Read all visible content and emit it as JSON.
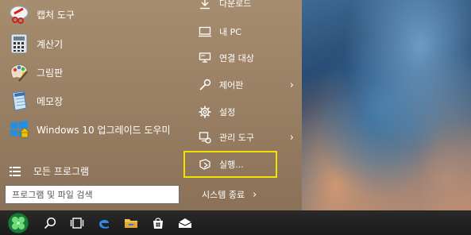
{
  "start_menu": {
    "apps": [
      {
        "label": "캡처 도구",
        "icon": "snipping-tool-icon"
      },
      {
        "label": "계산기",
        "icon": "calculator-icon"
      },
      {
        "label": "그림판",
        "icon": "paint-icon"
      },
      {
        "label": "메모장",
        "icon": "notepad-icon"
      },
      {
        "label": "Windows 10 업그레이드 도우미",
        "icon": "windows-upgrade-icon"
      }
    ],
    "all_programs_label": "모든 프로그램",
    "search_placeholder": "프로그램 및 파일 검색",
    "places": [
      {
        "label": "다운로드",
        "icon": "download-icon",
        "has_submenu": false
      },
      {
        "label": "내 PC",
        "icon": "computer-icon",
        "has_submenu": false
      },
      {
        "label": "연결 대상",
        "icon": "connect-to-icon",
        "has_submenu": false
      },
      {
        "label": "제어판",
        "icon": "control-panel-icon",
        "has_submenu": true
      },
      {
        "label": "설정",
        "icon": "gear-icon",
        "has_submenu": false
      },
      {
        "label": "관리 도구",
        "icon": "admin-tools-icon",
        "has_submenu": true
      },
      {
        "label": "실행...",
        "icon": "run-icon",
        "has_submenu": false
      }
    ],
    "shutdown_label": "시스템 종료",
    "chevron": "›"
  },
  "highlight": {
    "target": "실행...",
    "color": "#f2e200"
  },
  "taskbar": {
    "items": [
      "start-orb-icon",
      "search-icon",
      "task-view-icon",
      "edge-icon",
      "file-explorer-icon",
      "store-icon",
      "mail-icon"
    ]
  },
  "colors": {
    "menu_bg": "#9a8064",
    "taskbar_bg": "#1f1f1f",
    "text": "#ffffff"
  }
}
